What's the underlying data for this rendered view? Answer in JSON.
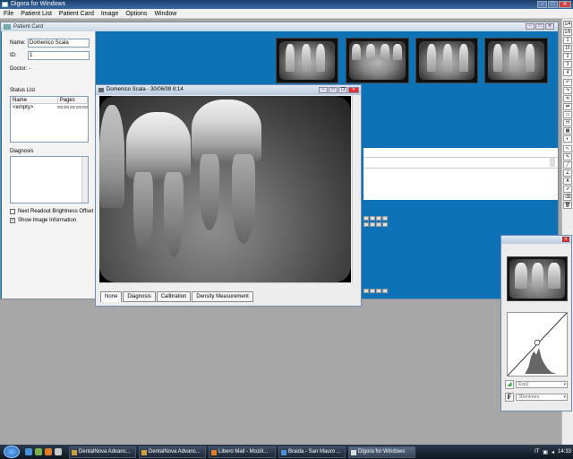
{
  "app": {
    "title": "Digora for Windows"
  },
  "menu": [
    "File",
    "Patient List",
    "Patient Card",
    "Image",
    "Options",
    "Window"
  ],
  "patient_card": {
    "title": "Patient Card",
    "name_label": "Name:",
    "name_value": "Domenico Scala",
    "id_label": "ID:",
    "id_value": "1",
    "doctor_label": "Doctor:",
    "doctor_value": "-",
    "status_list_label": "Status List",
    "status_cols": [
      "Name",
      "Pages"
    ],
    "status_rows": [
      {
        "name": "<empty>"
      }
    ],
    "diagnosis_label": "Diagnosis",
    "chk_readout": "Next Readout Brightness Offset",
    "chk_readout_checked": false,
    "chk_info": "Show Image Information",
    "chk_info_checked": true
  },
  "image_window": {
    "title": "Domenico Scala - 30/06/08 8:14",
    "tabs": [
      "None",
      "Diagnosis",
      "Calibration",
      "Density Measurement"
    ],
    "active_tab": "None"
  },
  "histogram": {
    "select1": "Exp1",
    "select2": "3Dentrees"
  },
  "right_toolbar": [
    "1/4",
    "1/6",
    "1",
    "15",
    "2",
    "3",
    "4"
  ],
  "taskbar": {
    "tasks": [
      "DentalNova Advanc...",
      "DentalNova Advanc...",
      "Libero Mail - Mozill...",
      "Braida - San Mauro ...",
      "Digora for Windows"
    ],
    "active_task": "Digora for Windows",
    "lang": "IT",
    "time": "14:33"
  }
}
